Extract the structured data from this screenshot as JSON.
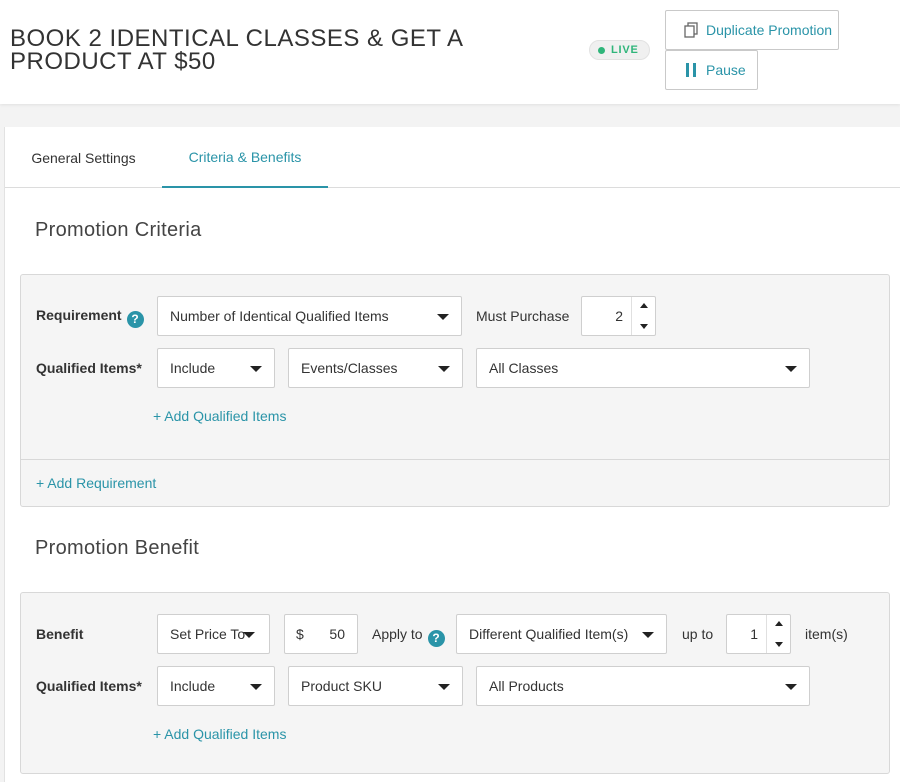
{
  "header": {
    "title": "BOOK 2 IDENTICAL CLASSES & GET A PRODUCT AT $50",
    "status": "LIVE",
    "duplicate_label": "Duplicate Promotion",
    "pause_label": "Pause"
  },
  "tabs": [
    {
      "label": "General Settings",
      "active": false
    },
    {
      "label": "Criteria & Benefits",
      "active": true
    }
  ],
  "criteria": {
    "section_title": "Promotion Criteria",
    "requirement_label": "Requirement",
    "requirement_value": "Number of Identical Qualified Items",
    "must_purchase_label": "Must Purchase",
    "must_purchase_value": "2",
    "qualified_label": "Qualified Items*",
    "include_value": "Include",
    "item_type_value": "Events/Classes",
    "items_value": "All Classes",
    "add_qualified_label": "+ Add Qualified Items",
    "add_requirement_label": "+ Add Requirement"
  },
  "benefit": {
    "section_title": "Promotion Benefit",
    "benefit_label": "Benefit",
    "benefit_type_value": "Set Price To",
    "currency": "$",
    "amount": "50",
    "apply_to_label": "Apply to",
    "apply_to_value": "Different Qualified Item(s)",
    "up_to_label": "up to",
    "up_to_value": "1",
    "items_suffix": "item(s)",
    "qualified_label": "Qualified Items*",
    "include_value": "Include",
    "item_type_value": "Product SKU",
    "items_value": "All Products",
    "add_qualified_label": "+ Add Qualified Items"
  },
  "colors": {
    "accent": "#2a94a8",
    "live": "#2fb57a"
  }
}
